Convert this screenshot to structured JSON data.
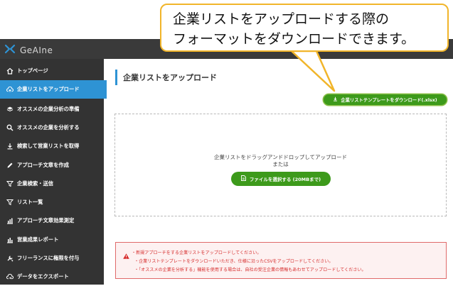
{
  "app": {
    "logo_text": "GeAIne"
  },
  "callout": {
    "line1": "企業リストをアップロードする際の",
    "line2": "フォーマットをダウンロードできます。"
  },
  "sidebar": {
    "items": [
      {
        "label": "トップページ",
        "icon": "home-icon"
      },
      {
        "label": "企業リストをアップロード",
        "icon": "cloud-upload-icon",
        "active": true
      },
      {
        "label": "オススメの企業分析の準備",
        "icon": "layers-icon"
      },
      {
        "label": "オススメの企業を分析する",
        "icon": "search-icon"
      },
      {
        "label": "検索して営業リストを取得",
        "icon": "download-icon"
      },
      {
        "label": "アプローチ文章を作成",
        "icon": "pencil-icon"
      },
      {
        "label": "企業検索・送信",
        "icon": "filter-icon"
      },
      {
        "label": "リスト一覧",
        "icon": "filter-list-icon"
      },
      {
        "label": "アプローチ文章効果測定",
        "icon": "bar-chart-icon"
      },
      {
        "label": "営業成果レポート",
        "icon": "report-chart-icon"
      },
      {
        "label": "フリーランスに権限を付与",
        "icon": "tools-icon"
      },
      {
        "label": "データをエクスポート",
        "icon": "cloud-export-icon"
      }
    ]
  },
  "main": {
    "title": "企業リストをアップロード",
    "template_button": "企業リストテンプレートをダウンロード(.xlsx)",
    "drop_text_1": "企業リストをドラッグアンドドロップしてアップロード",
    "drop_text_2": "または",
    "file_button": "ファイルを選択する (20MBまで)"
  },
  "alert": {
    "line1": "・新規アプローチをする企業リストをアップロードしてください。",
    "line2": "・企業リストテンプレートをダウンロードいただき、仕様に沿ったCSVをアップロードしてください。",
    "line3": "・「オススメの企業を分析する」機能を使用する場合は、自社の受注企業の情報もあわせてアップロードしてください。"
  },
  "colors": {
    "accent_blue": "#2e93d4",
    "green": "#3d9a1b",
    "sidebar_bg": "#333333",
    "callout_border": "#f1b52a",
    "alert_red": "#d62c2c"
  }
}
